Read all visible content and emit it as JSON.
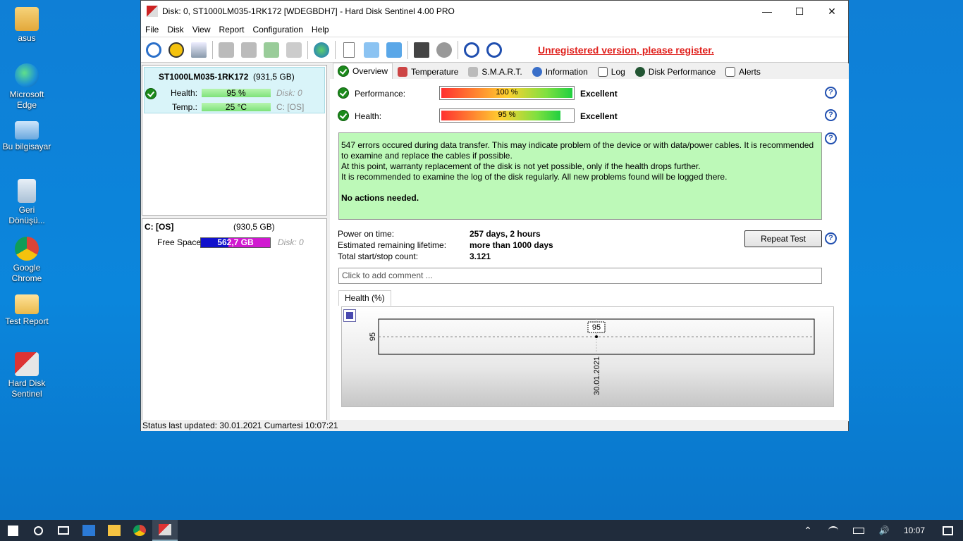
{
  "desktop": [
    {
      "label": "asus",
      "icon": "user-folder-icon"
    },
    {
      "label": "Microsoft Edge",
      "icon": "edge-icon"
    },
    {
      "label": "Bu bilgisayar",
      "icon": "computer-icon"
    },
    {
      "label": "Geri Dönüşü...",
      "icon": "recycle-bin-icon"
    },
    {
      "label": "Google Chrome",
      "icon": "chrome-icon"
    },
    {
      "label": "Test Report",
      "icon": "folder-icon"
    },
    {
      "label": "Hard Disk Sentinel",
      "icon": "hard-disk-sentinel-icon"
    }
  ],
  "window": {
    "title": "Disk: 0, ST1000LM035-1RK172 [WDEGBDH7]  -  Hard Disk Sentinel 4.00 PRO"
  },
  "menu": [
    "File",
    "Disk",
    "View",
    "Report",
    "Configuration",
    "Help"
  ],
  "toolbar": {
    "unregistered": "Unregistered version, please register."
  },
  "disk": {
    "name": "ST1000LM035-1RK172",
    "size": "(931,5 GB)",
    "health_label": "Health:",
    "health_value": "95 %",
    "health_pct": 95,
    "disk_label": "Disk: 0",
    "temp_label": "Temp.:",
    "temp_value": "25 °C",
    "drive_label": "C: [OS]"
  },
  "volume": {
    "name": "C: [OS]",
    "size": "(930,5 GB)",
    "free_label": "Free Space",
    "free_value": "562,7 GB",
    "disk_label": "Disk: 0"
  },
  "tabs": [
    "Overview",
    "Temperature",
    "S.M.A.R.T.",
    "Information",
    "Log",
    "Disk Performance",
    "Alerts"
  ],
  "overview": {
    "performance_label": "Performance:",
    "performance_value": "100 %",
    "performance_pct": 100,
    "performance_rating": "Excellent",
    "health_label": "Health:",
    "health_value": "95 %",
    "health_pct": 95,
    "health_rating": "Excellent",
    "message": [
      "547 errors occured during data transfer. This may indicate problem of the device or with data/power cables. It is recommended to examine and replace the cables if possible.",
      "At this point, warranty replacement of the disk is not yet possible, only if the health drops further.",
      "It is recommended to examine the log of the disk regularly. All new problems found will be logged there."
    ],
    "action": "No actions needed.",
    "power_on_label": "Power on time:",
    "power_on_value": "257 days, 2 hours",
    "lifetime_label": "Estimated remaining lifetime:",
    "lifetime_value": "more than 1000 days",
    "startstop_label": "Total start/stop count:",
    "startstop_value": "3.121",
    "repeat_button": "Repeat Test",
    "comment_placeholder": "Click to add comment ...",
    "graph_tab": "Health (%)"
  },
  "chart_data": {
    "type": "line",
    "x": [
      "30.01.2021"
    ],
    "values": [
      95
    ],
    "ylabel": "95",
    "xlabel": "",
    "data_labels": [
      "95"
    ]
  },
  "status": "Status last updated: 30.01.2021 Cumartesi 10:07:21",
  "taskbar": {
    "clock": "10:07"
  }
}
